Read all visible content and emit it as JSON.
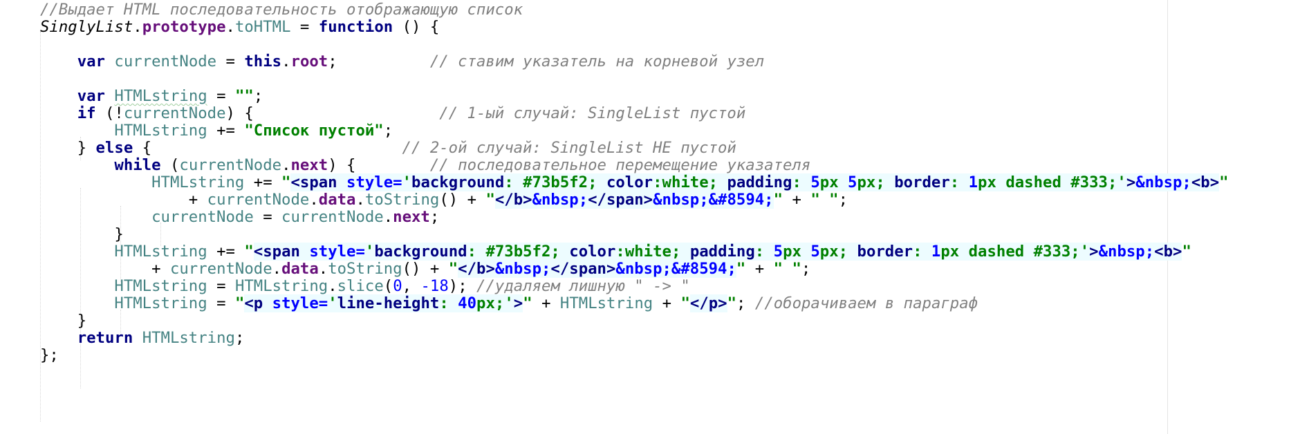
{
  "editor": {
    "language": "javascript",
    "lines": [
      [
        {
          "t": "//Выдает HTML последовательность отображающую список",
          "c": "cmt"
        }
      ],
      [
        {
          "t": "SinglyList",
          "c": "cls"
        },
        {
          "t": ".",
          "c": "plain"
        },
        {
          "t": "prototype",
          "c": "prop"
        },
        {
          "t": ".",
          "c": "plain"
        },
        {
          "t": "toHTML",
          "c": "fn"
        },
        {
          "t": " = ",
          "c": "plain"
        },
        {
          "t": "function",
          "c": "kw"
        },
        {
          "t": " () {",
          "c": "plain"
        }
      ],
      [],
      [
        {
          "t": "    ",
          "c": "plain"
        },
        {
          "t": "var",
          "c": "kw"
        },
        {
          "t": " ",
          "c": "plain"
        },
        {
          "t": "currentNode",
          "c": "lvar"
        },
        {
          "t": " = ",
          "c": "plain"
        },
        {
          "t": "this",
          "c": "kw"
        },
        {
          "t": ".",
          "c": "plain"
        },
        {
          "t": "root",
          "c": "fld"
        },
        {
          "t": ";          ",
          "c": "plain"
        },
        {
          "t": "// ставим указатель на корневой узел",
          "c": "cmt"
        }
      ],
      [],
      [
        {
          "t": "    ",
          "c": "plain"
        },
        {
          "t": "var",
          "c": "kw"
        },
        {
          "t": " ",
          "c": "plain"
        },
        {
          "t": "HTMLstring",
          "c": "lvar squig"
        },
        {
          "t": " = ",
          "c": "plain"
        },
        {
          "t": "\"\"",
          "c": "str"
        },
        {
          "t": ";",
          "c": "plain"
        }
      ],
      [
        {
          "t": "    ",
          "c": "plain"
        },
        {
          "t": "if",
          "c": "kw"
        },
        {
          "t": " (!",
          "c": "plain"
        },
        {
          "t": "currentNode",
          "c": "lvar"
        },
        {
          "t": ") {                    ",
          "c": "plain"
        },
        {
          "t": "// 1-ый случай: SingleList пустой",
          "c": "cmt"
        }
      ],
      [
        {
          "t": "        ",
          "c": "plain"
        },
        {
          "t": "HTMLstring",
          "c": "lvar"
        },
        {
          "t": " += ",
          "c": "plain"
        },
        {
          "t": "\"Список пустой\"",
          "c": "str"
        },
        {
          "t": ";",
          "c": "plain"
        }
      ],
      [
        {
          "t": "    } ",
          "c": "plain"
        },
        {
          "t": "else",
          "c": "kw"
        },
        {
          "t": " {                           ",
          "c": "plain"
        },
        {
          "t": "// 2-ой случай: SingleList НЕ пустой",
          "c": "cmt"
        }
      ],
      [
        {
          "t": "        ",
          "c": "plain"
        },
        {
          "t": "while",
          "c": "kw"
        },
        {
          "t": " (",
          "c": "plain"
        },
        {
          "t": "currentNode",
          "c": "lvar"
        },
        {
          "t": ".",
          "c": "plain"
        },
        {
          "t": "next",
          "c": "fld"
        },
        {
          "t": ") {        ",
          "c": "plain"
        },
        {
          "t": "// последовательное перемещение указателя",
          "c": "cmt"
        }
      ],
      [
        {
          "t": "            ",
          "c": "plain"
        },
        {
          "t": "HTMLstring",
          "c": "lvar"
        },
        {
          "t": " += ",
          "c": "plain"
        },
        {
          "t": "\"",
          "c": "str"
        },
        {
          "t": "<span ",
          "c": "tag"
        },
        {
          "t": "style=",
          "c": "attr"
        },
        {
          "t": "'",
          "c": "attrval"
        },
        {
          "t": "background",
          "c": "cssprop"
        },
        {
          "t": ": ",
          "c": "inj"
        },
        {
          "t": "#73b5f2",
          "c": "cssval"
        },
        {
          "t": "; ",
          "c": "inj"
        },
        {
          "t": "color",
          "c": "cssprop"
        },
        {
          "t": ":",
          "c": "inj"
        },
        {
          "t": "white",
          "c": "cssval"
        },
        {
          "t": "; ",
          "c": "inj"
        },
        {
          "t": "padding",
          "c": "cssprop"
        },
        {
          "t": ": ",
          "c": "inj"
        },
        {
          "t": "5",
          "c": "cssnum"
        },
        {
          "t": "px ",
          "c": "cssval"
        },
        {
          "t": "5",
          "c": "cssnum"
        },
        {
          "t": "px",
          "c": "cssval"
        },
        {
          "t": "; ",
          "c": "inj"
        },
        {
          "t": "border",
          "c": "cssprop"
        },
        {
          "t": ": ",
          "c": "inj"
        },
        {
          "t": "1",
          "c": "cssnum"
        },
        {
          "t": "px dashed #333",
          "c": "cssval"
        },
        {
          "t": ";",
          "c": "inj"
        },
        {
          "t": "'",
          "c": "attrval"
        },
        {
          "t": ">",
          "c": "tag"
        },
        {
          "t": "&nbsp;",
          "c": "ent"
        },
        {
          "t": "<b>",
          "c": "tag"
        },
        {
          "t": "\"",
          "c": "str"
        }
      ],
      [
        {
          "t": "                ",
          "c": "plain"
        },
        {
          "t": "+ ",
          "c": "plain"
        },
        {
          "t": "currentNode",
          "c": "lvar"
        },
        {
          "t": ".",
          "c": "plain"
        },
        {
          "t": "data",
          "c": "fld"
        },
        {
          "t": ".",
          "c": "plain"
        },
        {
          "t": "toString",
          "c": "fn"
        },
        {
          "t": "() + ",
          "c": "plain"
        },
        {
          "t": "\"",
          "c": "str"
        },
        {
          "t": "</b>",
          "c": "tag"
        },
        {
          "t": "&nbsp;",
          "c": "ent"
        },
        {
          "t": "</span>",
          "c": "tag"
        },
        {
          "t": "&nbsp;&#8594;",
          "c": "ent"
        },
        {
          "t": "\"",
          "c": "str"
        },
        {
          "t": " + ",
          "c": "plain"
        },
        {
          "t": "\" \"",
          "c": "str"
        },
        {
          "t": ";",
          "c": "plain"
        }
      ],
      [
        {
          "t": "            ",
          "c": "plain"
        },
        {
          "t": "currentNode",
          "c": "lvar"
        },
        {
          "t": " = ",
          "c": "plain"
        },
        {
          "t": "currentNode",
          "c": "lvar"
        },
        {
          "t": ".",
          "c": "plain"
        },
        {
          "t": "next",
          "c": "fld"
        },
        {
          "t": ";",
          "c": "plain"
        }
      ],
      [
        {
          "t": "        }",
          "c": "plain"
        }
      ],
      [
        {
          "t": "        ",
          "c": "plain"
        },
        {
          "t": "HTMLstring",
          "c": "lvar"
        },
        {
          "t": " += ",
          "c": "plain"
        },
        {
          "t": "\"",
          "c": "str"
        },
        {
          "t": "<span ",
          "c": "tag"
        },
        {
          "t": "style=",
          "c": "attr"
        },
        {
          "t": "'",
          "c": "attrval"
        },
        {
          "t": "background",
          "c": "cssprop"
        },
        {
          "t": ": ",
          "c": "inj"
        },
        {
          "t": "#73b5f2",
          "c": "cssval"
        },
        {
          "t": "; ",
          "c": "inj"
        },
        {
          "t": "color",
          "c": "cssprop"
        },
        {
          "t": ":",
          "c": "inj"
        },
        {
          "t": "white",
          "c": "cssval"
        },
        {
          "t": "; ",
          "c": "inj"
        },
        {
          "t": "padding",
          "c": "cssprop"
        },
        {
          "t": ": ",
          "c": "inj"
        },
        {
          "t": "5",
          "c": "cssnum"
        },
        {
          "t": "px ",
          "c": "cssval"
        },
        {
          "t": "5",
          "c": "cssnum"
        },
        {
          "t": "px",
          "c": "cssval"
        },
        {
          "t": "; ",
          "c": "inj"
        },
        {
          "t": "border",
          "c": "cssprop"
        },
        {
          "t": ": ",
          "c": "inj"
        },
        {
          "t": "1",
          "c": "cssnum"
        },
        {
          "t": "px dashed #333",
          "c": "cssval"
        },
        {
          "t": ";",
          "c": "inj"
        },
        {
          "t": "'",
          "c": "attrval"
        },
        {
          "t": ">",
          "c": "tag"
        },
        {
          "t": "&nbsp;",
          "c": "ent"
        },
        {
          "t": "<b>",
          "c": "tag"
        },
        {
          "t": "\"",
          "c": "str"
        }
      ],
      [
        {
          "t": "            ",
          "c": "plain"
        },
        {
          "t": "+ ",
          "c": "plain"
        },
        {
          "t": "currentNode",
          "c": "lvar"
        },
        {
          "t": ".",
          "c": "plain"
        },
        {
          "t": "data",
          "c": "fld"
        },
        {
          "t": ".",
          "c": "plain"
        },
        {
          "t": "toString",
          "c": "fn"
        },
        {
          "t": "() + ",
          "c": "plain"
        },
        {
          "t": "\"",
          "c": "str"
        },
        {
          "t": "</b>",
          "c": "tag"
        },
        {
          "t": "&nbsp;",
          "c": "ent"
        },
        {
          "t": "</span>",
          "c": "tag"
        },
        {
          "t": "&nbsp;&#8594;",
          "c": "ent"
        },
        {
          "t": "\"",
          "c": "str"
        },
        {
          "t": " + ",
          "c": "plain"
        },
        {
          "t": "\" \"",
          "c": "str"
        },
        {
          "t": ";",
          "c": "plain"
        }
      ],
      [
        {
          "t": "        ",
          "c": "plain"
        },
        {
          "t": "HTMLstring",
          "c": "lvar"
        },
        {
          "t": " = ",
          "c": "plain"
        },
        {
          "t": "HTMLstring",
          "c": "lvar"
        },
        {
          "t": ".",
          "c": "plain"
        },
        {
          "t": "slice",
          "c": "fn"
        },
        {
          "t": "(",
          "c": "plain"
        },
        {
          "t": "0",
          "c": "num"
        },
        {
          "t": ", ",
          "c": "plain"
        },
        {
          "t": "-18",
          "c": "num"
        },
        {
          "t": "); ",
          "c": "plain"
        },
        {
          "t": "//удаляем лишную \" -> \"",
          "c": "cmt"
        }
      ],
      [
        {
          "t": "        ",
          "c": "plain"
        },
        {
          "t": "HTMLstring",
          "c": "lvar"
        },
        {
          "t": " = ",
          "c": "plain"
        },
        {
          "t": "\"",
          "c": "str"
        },
        {
          "t": "<p ",
          "c": "tag"
        },
        {
          "t": "style=",
          "c": "attr"
        },
        {
          "t": "'",
          "c": "attrval"
        },
        {
          "t": "line-height",
          "c": "cssprop"
        },
        {
          "t": ": ",
          "c": "inj"
        },
        {
          "t": "40",
          "c": "cssnum"
        },
        {
          "t": "px",
          "c": "cssval"
        },
        {
          "t": ";",
          "c": "inj"
        },
        {
          "t": "'",
          "c": "attrval"
        },
        {
          "t": ">",
          "c": "tag"
        },
        {
          "t": "\"",
          "c": "str"
        },
        {
          "t": " + ",
          "c": "plain"
        },
        {
          "t": "HTMLstring",
          "c": "lvar"
        },
        {
          "t": " + ",
          "c": "plain"
        },
        {
          "t": "\"",
          "c": "str"
        },
        {
          "t": "</p>",
          "c": "tag"
        },
        {
          "t": "\"",
          "c": "str"
        },
        {
          "t": "; ",
          "c": "plain"
        },
        {
          "t": "//оборачиваем в параграф",
          "c": "cmt"
        }
      ],
      [
        {
          "t": "    }",
          "c": "plain"
        }
      ],
      [
        {
          "t": "    ",
          "c": "plain"
        },
        {
          "t": "return",
          "c": "kw"
        },
        {
          "t": " ",
          "c": "plain"
        },
        {
          "t": "HTMLstring",
          "c": "lvar"
        },
        {
          "t": ";",
          "c": "plain"
        }
      ],
      [
        {
          "t": "};",
          "c": "plain"
        }
      ]
    ]
  }
}
